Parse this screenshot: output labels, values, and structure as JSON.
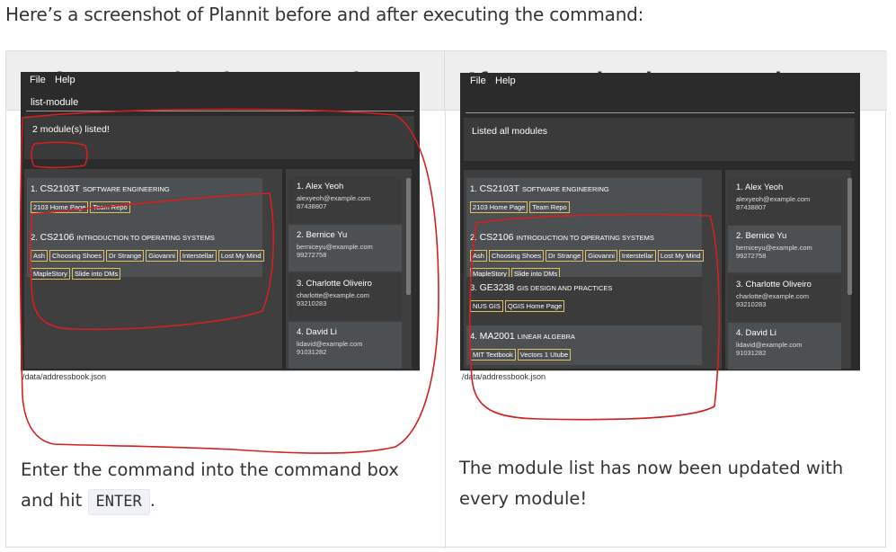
{
  "intro": "Here’s a screenshot of Plannit before and after executing the command:",
  "table": {
    "header_before": "Before executing the command",
    "header_after": "After executing the command"
  },
  "app": {
    "menu_file": "File",
    "menu_help": "Help",
    "status_path": "/data/addressbook.json"
  },
  "before": {
    "command": "list-module",
    "result": "2 module(s) listed!",
    "modules": [
      {
        "num": "1.",
        "code": "CS2103T",
        "name": "SOFTWARE ENGINEERING",
        "tags": [
          "2103 Home Page",
          "Team Repo"
        ]
      },
      {
        "num": "2.",
        "code": "CS2106",
        "name": "INTRODUCTION TO OPERATING SYSTEMS",
        "tags": [
          "Ash",
          "Choosing Shoes",
          "Dr Strange",
          "Giovanni",
          "Interstellar",
          "Lost My Mind",
          "MapleStory",
          "Slide into DMs"
        ]
      }
    ],
    "caption_text": "Enter the command into the command box and hit",
    "caption_key": "ENTER",
    "caption_end": "."
  },
  "after": {
    "command": "",
    "result": "Listed all modules",
    "modules": [
      {
        "num": "1.",
        "code": "CS2103T",
        "name": "SOFTWARE ENGINEERING",
        "tags": [
          "2103 Home Page",
          "Team Repo"
        ]
      },
      {
        "num": "2.",
        "code": "CS2106",
        "name": "INTRODUCTION TO OPERATING SYSTEMS",
        "tags": [
          "Ash",
          "Choosing Shoes",
          "Dr Strange",
          "Giovanni",
          "Interstellar",
          "Lost My Mind",
          "MapleStory",
          "Slide into DMs"
        ]
      },
      {
        "num": "3.",
        "code": "GE3238",
        "name": "GIS DESIGN AND PRACTICES",
        "tags": [
          "NUS GIS",
          "QGIS Home Page"
        ]
      },
      {
        "num": "4.",
        "code": "MA2001",
        "name": "LINEAR ALGEBRA",
        "tags": [
          "MIT Textbook",
          "Vectors 1 Utube"
        ]
      }
    ],
    "caption": "The module list has now been updated with every module!"
  },
  "persons": [
    {
      "name": "1.  Alex Yeoh",
      "email": "alexyeoh@example.com",
      "phone": "87438807"
    },
    {
      "name": "2.  Bernice Yu",
      "email": "berniceyu@example.com",
      "phone": "99272758"
    },
    {
      "name": "3.  Charlotte Oliveiro",
      "email": "charlotte@example.com",
      "phone": "93210283"
    },
    {
      "name": "4.  David Li",
      "email": "lidavid@example.com",
      "phone": "91031282"
    }
  ],
  "colors": {
    "app_bg": "#2b2b2b",
    "card_alt": "#4d5053",
    "tag_border": "#e0c060",
    "annotation": "#d42020"
  }
}
